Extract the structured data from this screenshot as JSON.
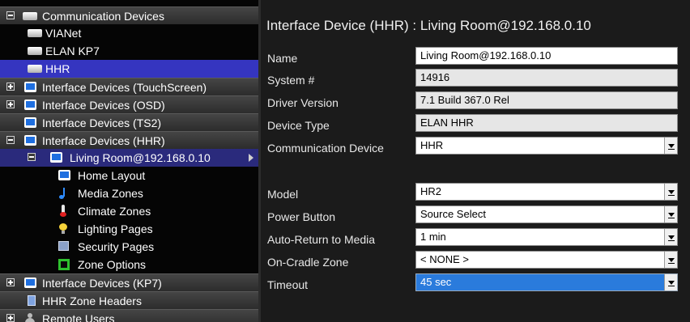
{
  "tree": {
    "items": [
      {
        "label": "Communication Devices",
        "toggle": "minus",
        "icon": "comm-device-icon"
      },
      {
        "label": "VIANet",
        "icon": "comm-device-icon"
      },
      {
        "label": "ELAN KP7",
        "icon": "comm-device-icon"
      },
      {
        "label": "HHR",
        "icon": "comm-device-icon"
      },
      {
        "label": "Interface Devices (TouchScreen)",
        "toggle": "plus",
        "icon": "monitor-icon"
      },
      {
        "label": "Interface Devices (OSD)",
        "toggle": "plus",
        "icon": "monitor-icon"
      },
      {
        "label": "Interface Devices (TS2)",
        "icon": "monitor-icon"
      },
      {
        "label": "Interface Devices (HHR)",
        "toggle": "minus",
        "icon": "monitor-icon"
      },
      {
        "label": "Living Room@192.168.0.10",
        "toggle": "minus",
        "icon": "monitor-icon"
      },
      {
        "label": "Home Layout",
        "icon": "monitor-icon"
      },
      {
        "label": "Media Zones",
        "icon": "music-note-icon"
      },
      {
        "label": "Climate Zones",
        "icon": "thermometer-icon"
      },
      {
        "label": "Lighting Pages",
        "icon": "light-bulb-icon"
      },
      {
        "label": "Security Pages",
        "icon": "security-icon"
      },
      {
        "label": "Zone Options",
        "icon": "zone-options-icon"
      },
      {
        "label": "Interface Devices (KP7)",
        "toggle": "plus",
        "icon": "monitor-icon"
      },
      {
        "label": "HHR Zone Headers",
        "icon": "header-icon"
      },
      {
        "label": "Remote Users",
        "toggle": "plus",
        "icon": "user-icon"
      }
    ]
  },
  "panel": {
    "title": "Interface Device (HHR) : Living Room@192.168.0.10",
    "fields": [
      {
        "label": "Name",
        "value": "Living Room@192.168.0.10"
      },
      {
        "label": "System #",
        "value": "14916"
      },
      {
        "label": "Driver Version",
        "value": "7.1 Build 367.0 Rel"
      },
      {
        "label": "Device Type",
        "value": "ELAN HHR"
      },
      {
        "label": "Communication Device",
        "value": "HHR"
      },
      {
        "label": "Model",
        "value": "HR2"
      },
      {
        "label": "Power Button",
        "value": "Source Select"
      },
      {
        "label": "Auto-Return to Media",
        "value": "1 min"
      },
      {
        "label": "On-Cradle Zone",
        "value": "< NONE >"
      },
      {
        "label": "Timeout",
        "value": "45 sec"
      }
    ]
  },
  "colors": {
    "selected_item": "#3535c0",
    "selected_field": "#2a7bdc",
    "background": "#1b1b1b"
  }
}
